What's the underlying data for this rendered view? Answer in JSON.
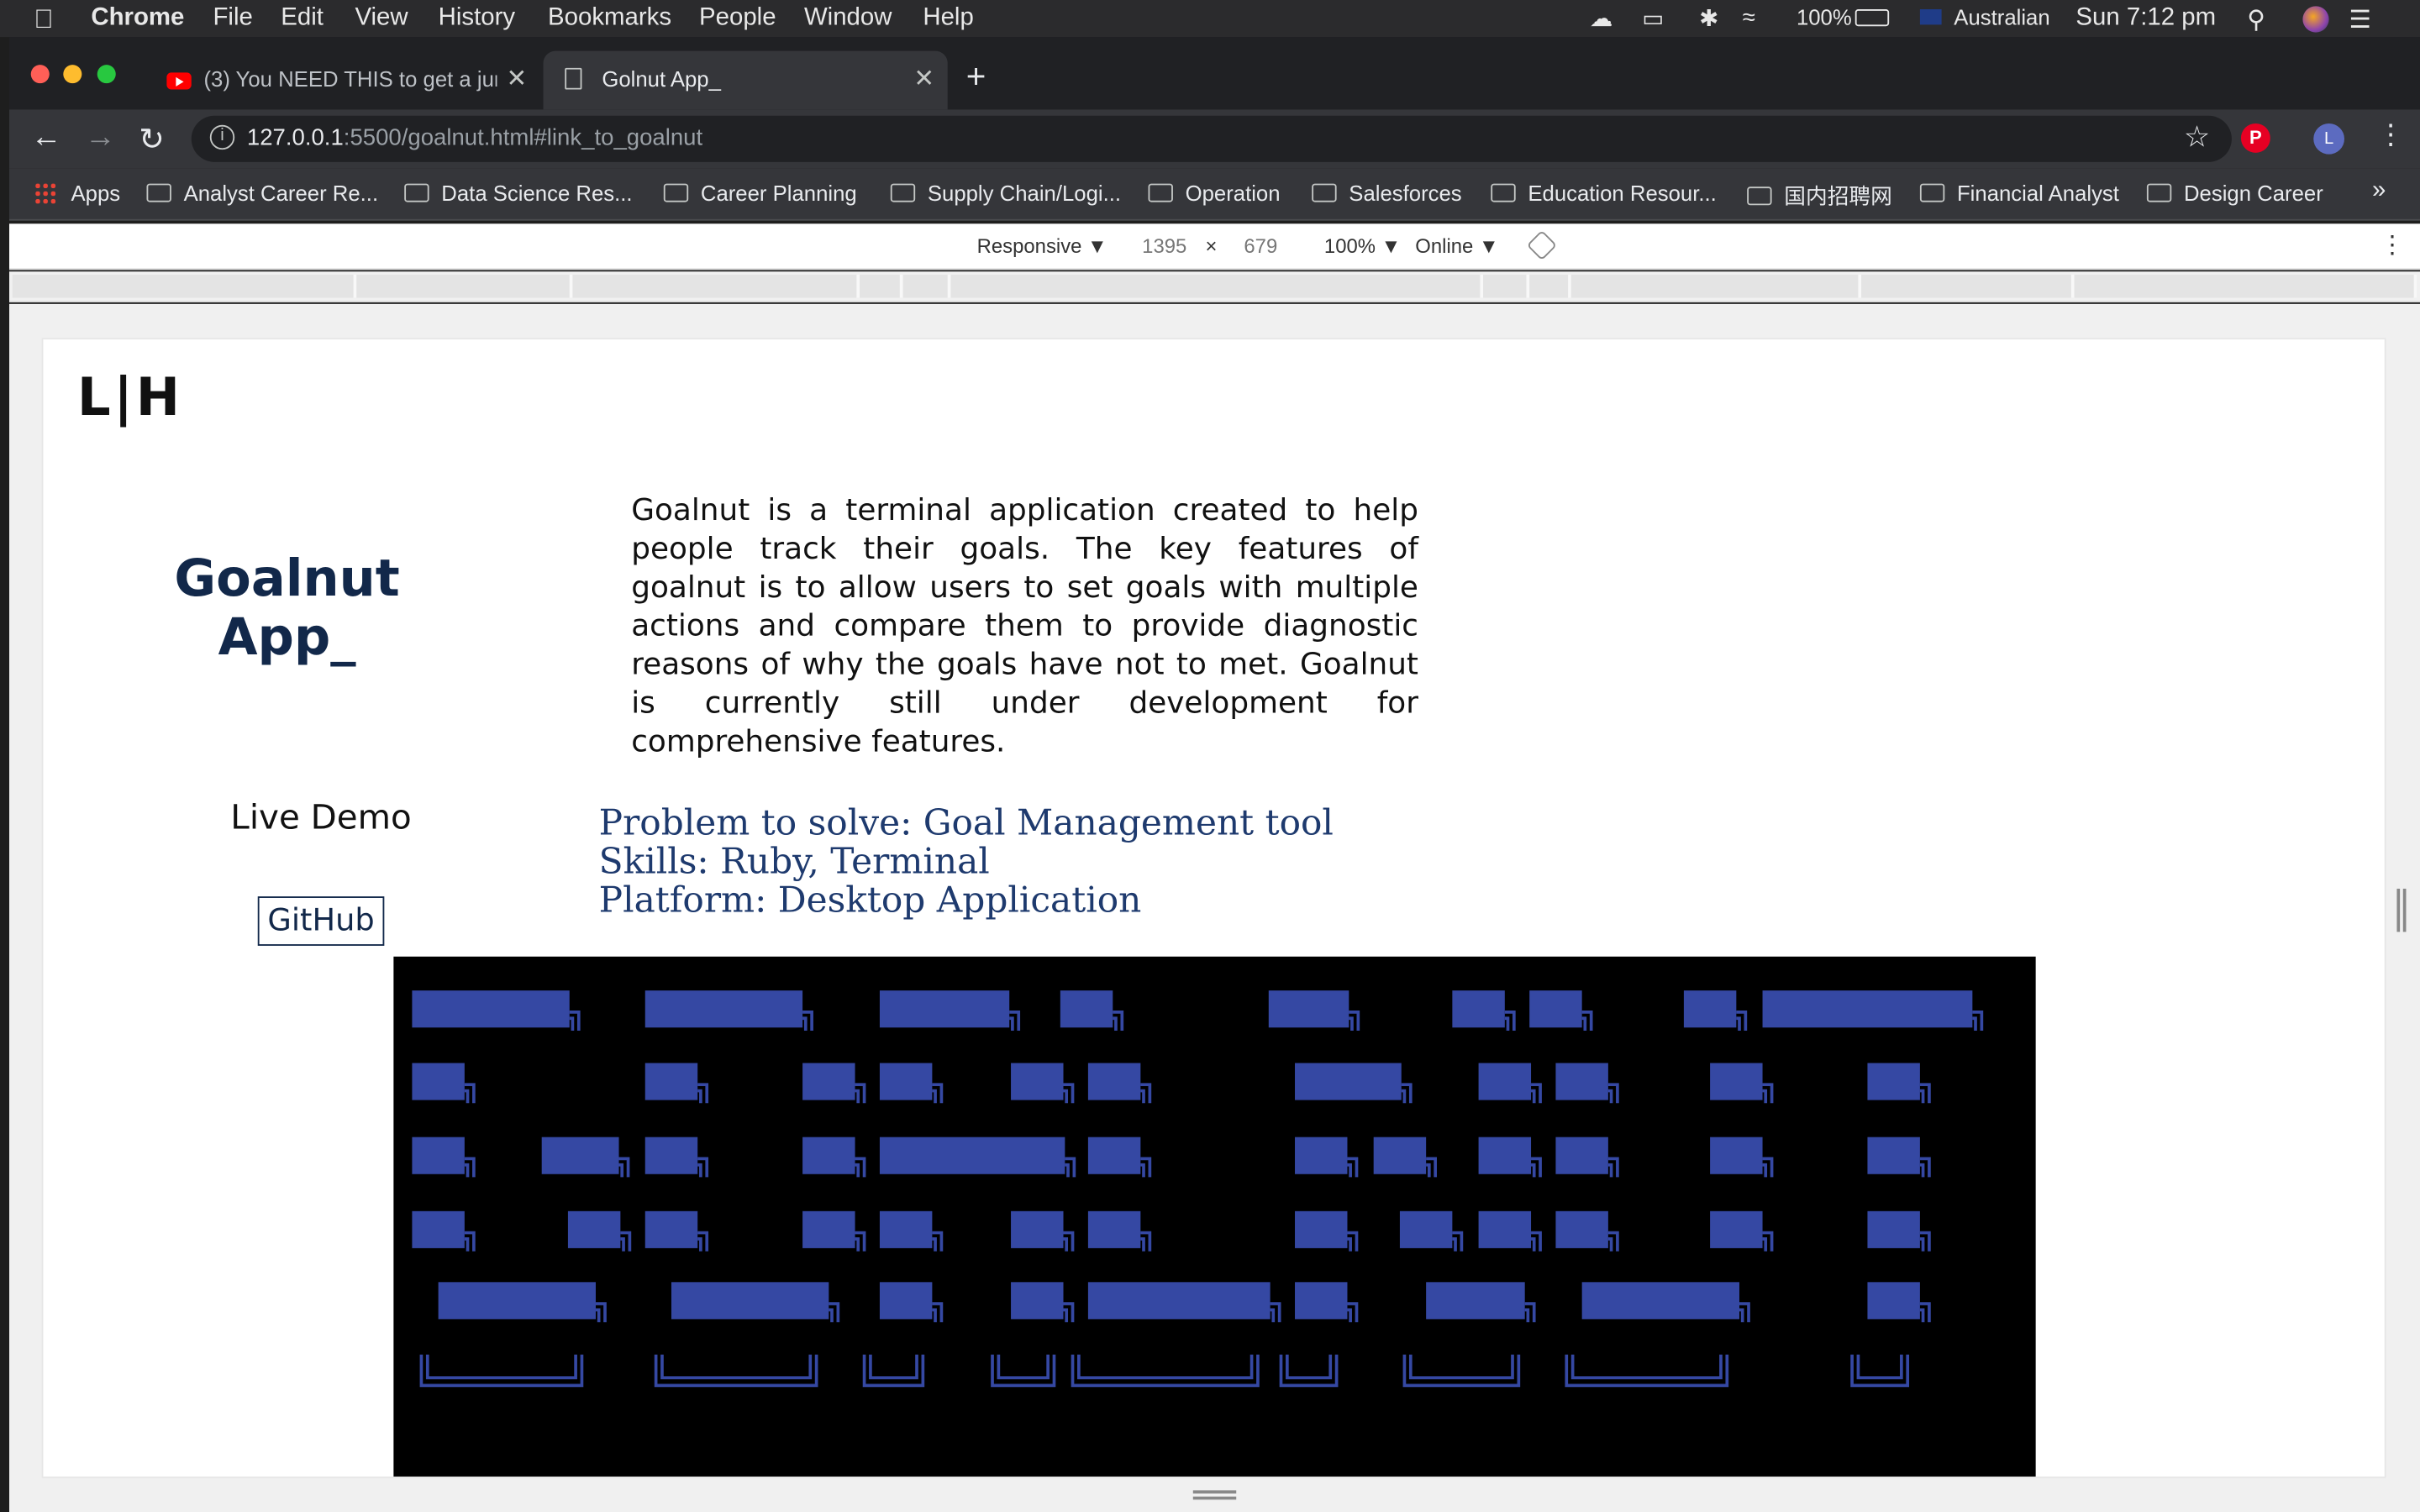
{
  "menubar": {
    "apple_icon": "apple-icon",
    "app_name": "Chrome",
    "menus": [
      "File",
      "Edit",
      "View",
      "History",
      "Bookmarks",
      "People",
      "Window",
      "Help"
    ],
    "battery": "100%",
    "input_source": "Australian",
    "clock": "Sun 7:12 pm"
  },
  "tabs": [
    {
      "title": "(3) You NEED THIS to get a jun",
      "icon": "youtube-icon",
      "active": false
    },
    {
      "title": "Golnut App_",
      "icon": "document-icon",
      "active": true
    }
  ],
  "new_tab_label": "+",
  "omnibox": {
    "host": "127.0.0.1",
    "path": ":5500/goalnut.html#link_to_goalnut"
  },
  "profile_initial": "L",
  "bookmarks": {
    "apps_label": "Apps",
    "items": [
      "Analyst Career Re...",
      "Data Science Res...",
      "Career Planning",
      "Supply Chain/Logi...",
      "Operation",
      "Salesforces",
      "Education Resour...",
      "国内招聘网",
      "Financial Analyst",
      "Design Career"
    ],
    "overflow": "»"
  },
  "device_toolbar": {
    "mode": "Responsive ▼",
    "width": "1395",
    "times": "×",
    "height": "679",
    "zoom": "100% ▼",
    "network": "Online ▼"
  },
  "page": {
    "logo": "L|H",
    "title_line1": "Goalnut",
    "title_line2": "App_",
    "description": "Goalnut is a terminal application created to help people track their goals. The key features of goalnut is to allow users to set goals with multiple actions and compare them to provide diagnostic reasons of why the goals have not to met. Goalnut is currently still under development for comprehensive features.",
    "live_demo": "Live Demo",
    "github": "GitHub",
    "problem": "Problem to solve: Goal Management tool",
    "skills": "Skills: Ruby, Terminal",
    "platform": "Platform: Desktop Application"
  },
  "colors": {
    "title_navy": "#12284a",
    "spec_blue": "#1e3a6e",
    "ascii_block": "#3548a3",
    "ascii_bg": "#000000"
  }
}
